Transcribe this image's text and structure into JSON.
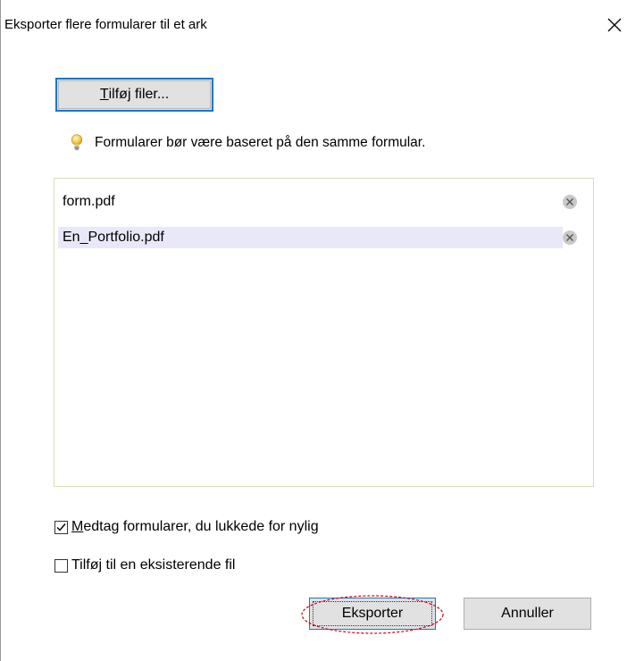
{
  "window": {
    "title": "Eksporter flere formularer til et ark",
    "close_icon": "close-icon"
  },
  "toolbar": {
    "add_files_label_accel": "T",
    "add_files_label_rest": "ilføj filer..."
  },
  "hint": {
    "icon": "lightbulb-icon",
    "text": "Formularer bør være baseret på den samme formular."
  },
  "files": [
    {
      "name": "form.pdf",
      "selected": false
    },
    {
      "name": "En_Portfolio.pdf",
      "selected": true
    }
  ],
  "options": {
    "include_recent": {
      "accel": "M",
      "rest": "edtag formularer, du lukkede for nylig",
      "checked": true
    },
    "append_existing": {
      "label": "Tilføj til en eksisterende fil",
      "checked": false
    }
  },
  "buttons": {
    "export_label": "Eksporter",
    "cancel_label": "Annuller"
  },
  "colors": {
    "focus_blue": "#1a76cc",
    "selection": "#e8e8f8",
    "highlight_ellipse": "#d0021b",
    "button_face": "#e1e1e1"
  }
}
